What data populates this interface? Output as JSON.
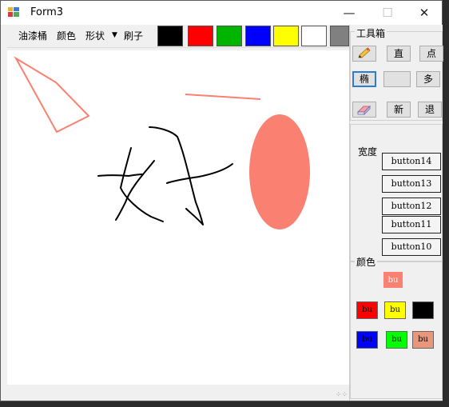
{
  "window": {
    "title": "Form3"
  },
  "toolbar": {
    "menus": [
      "油漆桶",
      "颜色",
      "形状",
      "刷子"
    ],
    "swatches": [
      "#000000",
      "#ff0000",
      "#00b400",
      "#0000ff",
      "#ffff00",
      "#ffffff",
      "#808080"
    ]
  },
  "toolbox": {
    "title": "工具箱",
    "row1": {
      "pencil_icon": "pencil-icon",
      "line": "直",
      "point": "点"
    },
    "row2": {
      "ellipse": "椭",
      "blank": "",
      "polygon": "多"
    },
    "row3": {
      "eraser_icon": "eraser-icon",
      "new": "新",
      "exit": "退"
    }
  },
  "width": {
    "label": "宽度",
    "buttons": [
      "button14",
      "button13",
      "button12",
      "button11",
      "button10"
    ]
  },
  "colors": {
    "label": "颜色",
    "current": {
      "text": "bu",
      "color": "#fa8072"
    },
    "buttons": [
      {
        "text": "bu",
        "color": "#ff0000"
      },
      {
        "text": "bu",
        "color": "#ffff00"
      },
      {
        "text": "bu",
        "color": "#000000"
      },
      {
        "text": "bu",
        "color": "#0000ff"
      },
      {
        "text": "bu",
        "color": "#00ff00"
      },
      {
        "text": "bu",
        "color": "#e9967a"
      }
    ]
  },
  "canvas": {
    "stroke_color": "#fa8072",
    "fill_color": "#fa8072",
    "ink_color": "#000000"
  }
}
